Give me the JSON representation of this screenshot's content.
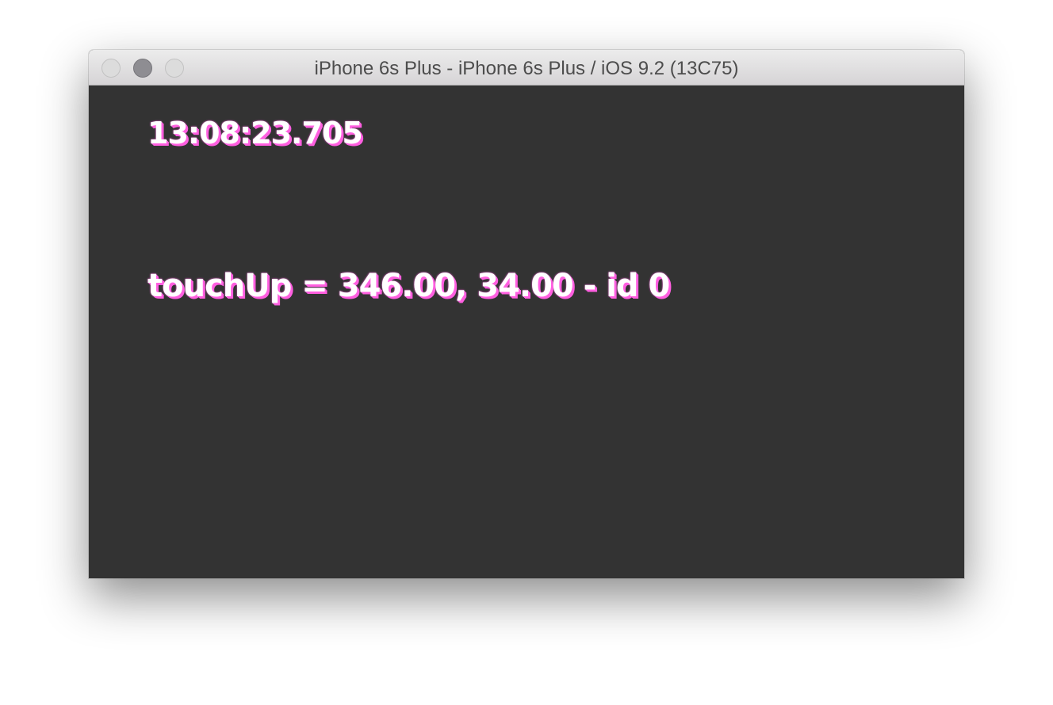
{
  "window": {
    "title": "iPhone 6s Plus - iPhone 6s Plus / iOS 9.2 (13C75)"
  },
  "screen": {
    "clock": "13:08:23.705",
    "touch_event": "touchUp = 346.00, 34.00 - id 0"
  },
  "colors": {
    "screen_background": "#333333",
    "text_fill": "#ffffff",
    "text_shadow": "#ff5fe0"
  }
}
